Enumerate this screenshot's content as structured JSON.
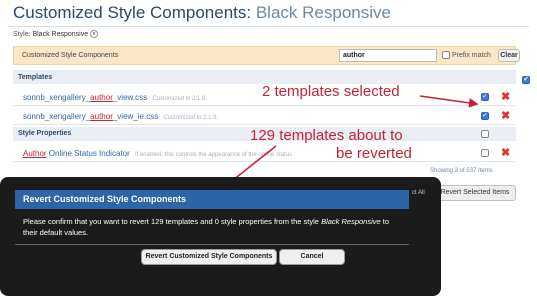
{
  "page": {
    "title_main": "Customized Style Components: ",
    "title_sub": "Black Responsive",
    "style_label": "Style: ",
    "style_value": "Black Responsive"
  },
  "filter": {
    "label": "Customized Style Components",
    "search_value": "author",
    "prefix_label": "Prefix match",
    "clear_label": "Clear"
  },
  "sections": {
    "templates": "Templates",
    "style_properties": "Style Properties"
  },
  "templates": [
    {
      "pre": "sonnb_xengallery_",
      "hl": "author",
      "post": "_view.css",
      "note": "Customized in 2.1.9.",
      "checked": true
    },
    {
      "pre": "sonnb_xengallery_",
      "hl": "author",
      "post": "_view_ie.css",
      "note": "Customized in 2.1.9.",
      "checked": true
    }
  ],
  "properties": [
    {
      "hl": "Author",
      "post": " Online Status Indicator",
      "note": "If enabled, this controls the appearance of the online status",
      "checked": false
    }
  ],
  "footer": {
    "showing": "Showing 3 of 537 Items",
    "revert_selected": "Revert Selected Items",
    "peek": "ct All"
  },
  "annotations": {
    "selected": "2 templates selected",
    "reverted_line1": "129 templates about to",
    "reverted_line2": "be reverted"
  },
  "dialog": {
    "title": "Revert Customized Style Components",
    "body_pre": "Please confirm that you want to revert 129 templates and 0 style properties from the style ",
    "body_style": "Black Responsive",
    "body_post": " to their default values.",
    "confirm": "Revert Customized Style Components",
    "cancel": "Cancel"
  },
  "colors": {
    "accent_red": "#c42431",
    "header_blue": "#2d66a8",
    "filter_bg": "#fbe6c7"
  }
}
